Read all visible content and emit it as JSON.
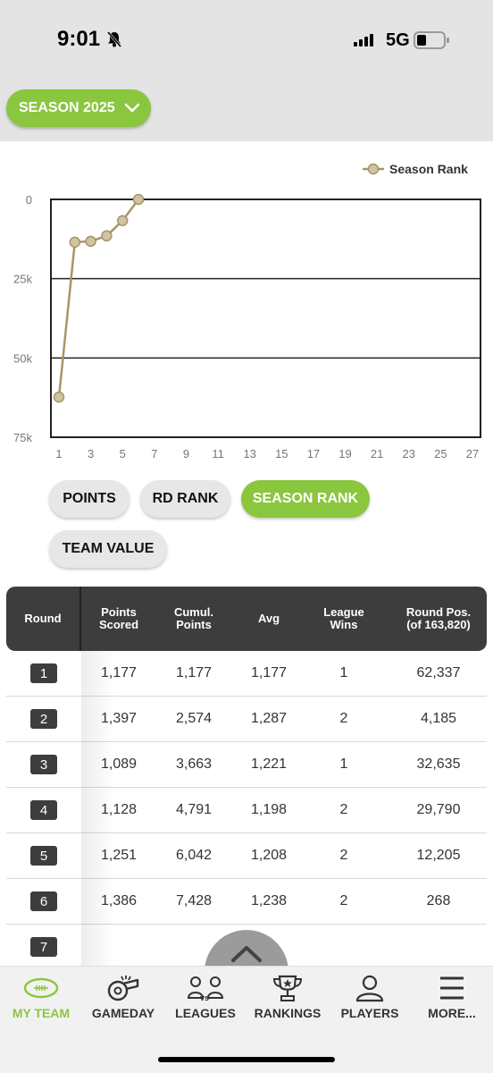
{
  "status": {
    "time": "9:01",
    "network": "5G"
  },
  "season_selector": {
    "label": "SEASON 2025"
  },
  "chart_data": {
    "type": "line",
    "legend": "Season Rank",
    "legend_position": "top-right",
    "x_ticks": [
      "1",
      "3",
      "5",
      "7",
      "9",
      "11",
      "13",
      "15",
      "17",
      "19",
      "21",
      "23",
      "25",
      "27"
    ],
    "y_ticks": [
      "0",
      "25k",
      "50k",
      "75k"
    ],
    "ylim": [
      75000,
      0
    ],
    "xlim": [
      1,
      27
    ],
    "series": [
      {
        "name": "Season Rank",
        "x": [
          1,
          2,
          3,
          4,
          5,
          6
        ],
        "y": [
          62337,
          13500,
          13200,
          11500,
          6700,
          0
        ]
      }
    ],
    "line_color": "#a89468",
    "grid": true
  },
  "tabs": [
    "POINTS",
    "RD RANK",
    "SEASON RANK",
    "TEAM VALUE"
  ],
  "table": {
    "headers": {
      "round": "Round",
      "points": [
        "Points",
        "Scored"
      ],
      "cumul": [
        "Cumul.",
        "Points"
      ],
      "avg": "Avg",
      "league": [
        "League",
        "Wins"
      ],
      "pos": [
        "Round Pos.",
        "(of 163,820)"
      ]
    },
    "rows": [
      {
        "round": "1",
        "points": "1,177",
        "cumul": "1,177",
        "avg": "1,177",
        "wins": "1",
        "pos": "62,337"
      },
      {
        "round": "2",
        "points": "1,397",
        "cumul": "2,574",
        "avg": "1,287",
        "wins": "2",
        "pos": "4,185"
      },
      {
        "round": "3",
        "points": "1,089",
        "cumul": "3,663",
        "avg": "1,221",
        "wins": "1",
        "pos": "32,635"
      },
      {
        "round": "4",
        "points": "1,128",
        "cumul": "4,791",
        "avg": "1,198",
        "wins": "2",
        "pos": "29,790"
      },
      {
        "round": "5",
        "points": "1,251",
        "cumul": "6,042",
        "avg": "1,208",
        "wins": "2",
        "pos": "12,205"
      },
      {
        "round": "6",
        "points": "1,386",
        "cumul": "7,428",
        "avg": "1,238",
        "wins": "2",
        "pos": "268"
      },
      {
        "round": "7",
        "points": "",
        "cumul": "",
        "avg": "",
        "wins": "",
        "pos": ""
      }
    ]
  },
  "nav": [
    "MY TEAM",
    "GAMEDAY",
    "LEAGUES",
    "RANKINGS",
    "PLAYERS",
    "MORE..."
  ],
  "colors": {
    "accent": "#8bc63f",
    "dark": "#3d3d3d"
  }
}
